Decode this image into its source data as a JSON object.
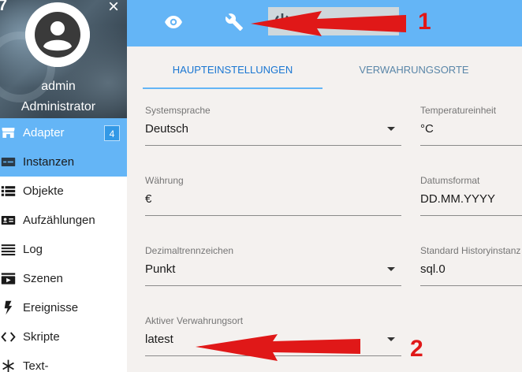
{
  "sidebar": {
    "corner_digit": "7",
    "close_symbol": "×",
    "user": {
      "name": "admin",
      "role": "Administrator"
    },
    "items": [
      {
        "label": "Adapter",
        "icon": "store-icon",
        "badge": "4",
        "state": "selected"
      },
      {
        "label": "Instanzen",
        "icon": "instances-icon",
        "state": "secondary"
      },
      {
        "label": "Objekte",
        "icon": "list-icon"
      },
      {
        "label": "Aufzählungen",
        "icon": "contacts-card-icon"
      },
      {
        "label": "Log",
        "icon": "lines-icon"
      },
      {
        "label": "Szenen",
        "icon": "scenes-icon"
      },
      {
        "label": "Ereignisse",
        "icon": "flash-icon"
      },
      {
        "label": "Skripte",
        "icon": "code-icon"
      },
      {
        "label": "Text-",
        "icon": "snowflake-icon"
      }
    ]
  },
  "topbar": {
    "icons": [
      "eye-icon",
      "wrench-icon",
      "power-icon"
    ]
  },
  "tabs": [
    {
      "label": "HAUPTEINSTELLUNGEN",
      "active": true
    },
    {
      "label": "VERWAHRUNGSORTE",
      "active": false
    }
  ],
  "form": {
    "system_language": {
      "label": "Systemsprache",
      "value": "Deutsch"
    },
    "temperature_unit": {
      "label": "Temperatureinheit",
      "value": "°C"
    },
    "currency": {
      "label": "Währung",
      "value": "€"
    },
    "date_format": {
      "label": "Datumsformat",
      "value": "DD.MM.YYYY"
    },
    "decimal_separator": {
      "label": "Dezimaltrennzeichen",
      "value": "Punkt"
    },
    "history_instance": {
      "label": "Standard Historyinstanz",
      "value": "sql.0"
    },
    "active_storage": {
      "label": "Aktiver Verwahrungsort",
      "value": "latest"
    }
  },
  "annotations": {
    "arrow_1_label": "1",
    "arrow_2_label": "2",
    "color": "#e01818"
  },
  "colors": {
    "primary": "#64b5f6",
    "tab_active": "#1976d2",
    "badge": "#3399e6",
    "background": "#f4f1ef"
  }
}
